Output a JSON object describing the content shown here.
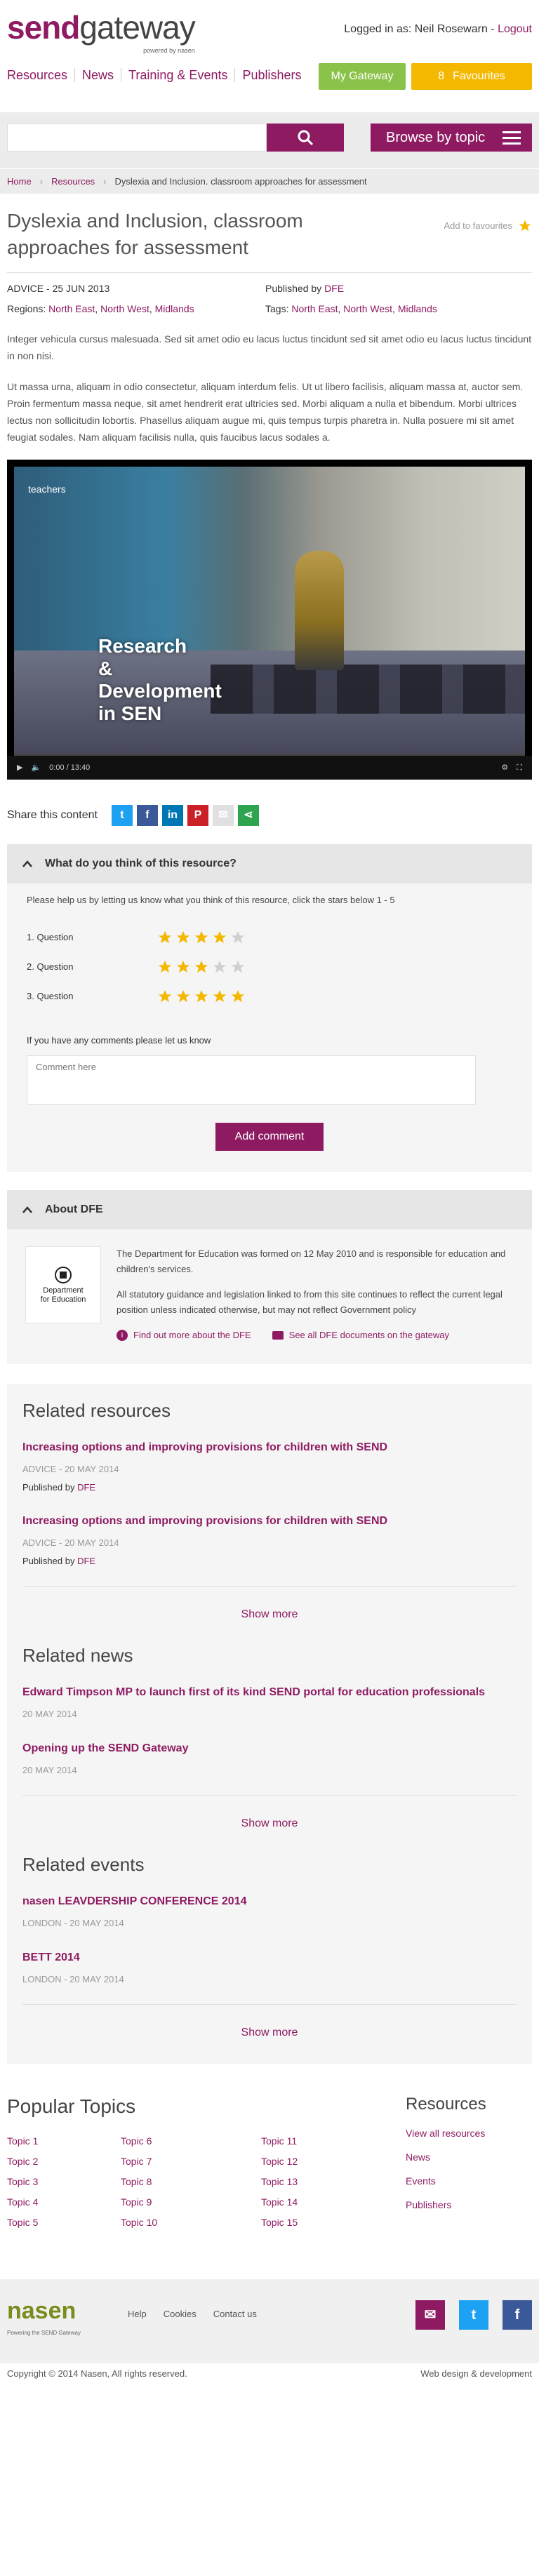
{
  "header": {
    "logo_send": "send",
    "logo_gateway": "gateway",
    "logo_sub": "powered by nasen",
    "login_text": "Logged in as: Neil Rosewarn - ",
    "logout": "Logout",
    "nav": [
      "Resources",
      "News",
      "Training & Events",
      "Publishers"
    ],
    "my_gateway": "My Gateway",
    "fav_count": "8",
    "favourites": "Favourites",
    "colors": {
      "brand": "#8e1b62",
      "green": "#8bc34a",
      "yellow": "#f5b800"
    }
  },
  "search": {
    "placeholder": "",
    "browse": "Browse by topic"
  },
  "breadcrumb": [
    "Home",
    "Resources",
    "Dyslexia and Inclusion. classroom approaches for assessment"
  ],
  "article": {
    "title": "Dyslexia and Inclusion, classroom approaches for assessment",
    "add_fav": "Add to favourites",
    "date": "ADVICE - 25 JUN 2013",
    "published_label": "Published by ",
    "publisher": "DFE",
    "regions_label": "Regions: ",
    "regions": [
      "North East",
      "North West",
      "Midlands"
    ],
    "tags_label": "Tags: ",
    "tags": [
      "North East",
      "North West",
      "Midlands"
    ],
    "para1": "Integer vehicula cursus malesuada. Sed sit amet odio eu lacus luctus tincidunt sed sit amet odio eu lacus luctus tincidunt in non nisi.",
    "para2": "Ut massa urna, aliquam in odio consectetur, aliquam interdum felis. Ut ut libero facilisis, aliquam massa at, auctor sem. Proin fermentum massa neque, sit amet hendrerit erat ultricies sed. Morbi aliquam a nulla et bibendum. Morbi ultrices lectus non sollicitudin lobortis. Phasellus aliquam augue mi, quis tempus turpis pharetra in. Nulla posuere mi sit amet feugiat sodales. Nam aliquam facilisis nulla, quis faucibus lacus sodales a."
  },
  "video": {
    "logo": "teachers",
    "caption": [
      "Research",
      "&",
      "Development",
      "in SEN"
    ],
    "time": "0:00 / 13:40",
    "progress": 0.0
  },
  "share": {
    "label": "Share this content"
  },
  "rating": {
    "heading": "What do you think of this resource?",
    "intro": "Please help us by letting us know what you think of this resource, click the stars below 1 - 5",
    "questions": [
      {
        "label": "1. Question",
        "stars": 4
      },
      {
        "label": "2. Question",
        "stars": 3
      },
      {
        "label": "3. Question",
        "stars": 5
      }
    ],
    "comments_label": "If you have any comments please let us know",
    "comment_placeholder": "Comment here",
    "add_comment": "Add comment"
  },
  "about": {
    "heading": "About DFE",
    "logo_text": [
      "Department",
      "for Education"
    ],
    "p1": "The Department for Education was formed on 12 May 2010 and is responsible for education and children's services.",
    "p2": "All statutory guidance and legislation linked to from this site continues to reflect the current legal position unless indicated otherwise, but may not reflect Government policy",
    "link1": "Find out more about the DFE",
    "link2": "See all DFE documents on the gateway"
  },
  "related_resources": {
    "heading": "Related resources",
    "items": [
      {
        "title": "Increasing options and improving provisions for children with SEND",
        "date": "ADVICE - 20 MAY 2014",
        "pub_label": "Published by ",
        "publisher": "DFE"
      },
      {
        "title": "Increasing options and improving provisions for children with SEND",
        "date": "ADVICE - 20 MAY 2014",
        "pub_label": "Published by ",
        "publisher": "DFE"
      }
    ],
    "show_more": "Show more"
  },
  "related_news": {
    "heading": "Related news",
    "items": [
      {
        "title": "Edward Timpson MP to launch first of its kind SEND portal for education professionals",
        "date": "20 MAY 2014"
      },
      {
        "title": "Opening up the SEND Gateway",
        "date": "20 MAY 2014"
      }
    ],
    "show_more": "Show more"
  },
  "related_events": {
    "heading": "Related events",
    "items": [
      {
        "title": "nasen LEAVDERSHIP CONFERENCE 2014",
        "date": "LONDON - 20 MAY 2014"
      },
      {
        "title": "BETT 2014",
        "date": "LONDON - 20 MAY 2014"
      }
    ],
    "show_more": "Show more"
  },
  "popular": {
    "heading": "Popular Topics",
    "topics": [
      "Topic 1",
      "Topic 6",
      "Topic 11",
      "Topic 2",
      "Topic 7",
      "Topic 12",
      "Topic 3",
      "Topic 8",
      "Topic 13",
      "Topic 4",
      "Topic 9",
      "Topic 14",
      "Topic 5",
      "Topic 10",
      "Topic 15"
    ]
  },
  "resources_list": {
    "heading": "Resources",
    "items": [
      "View all resources",
      "News",
      "Events",
      "Publishers"
    ]
  },
  "footer": {
    "logo": "nasen",
    "logo_sub": "Powering the SEND Gateway",
    "links": [
      "Help",
      "Cookies",
      "Contact us"
    ],
    "copyright": "Copyright © 2014 Nasen, All rights reserved.",
    "credit": "Web design & development"
  }
}
